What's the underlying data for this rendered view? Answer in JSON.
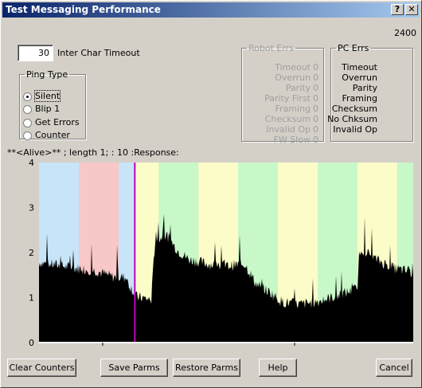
{
  "window": {
    "title": "Test Messaging Performance",
    "help_glyph": "?",
    "close_glyph": "✕"
  },
  "top_right_value": "2400",
  "inter_char": {
    "value": "30",
    "label": "Inter Char Timeout"
  },
  "ping_type": {
    "legend": "Ping Type",
    "options": [
      "Silent",
      "Blip 1",
      "Get Errors",
      "Counter"
    ],
    "selected": "Silent"
  },
  "robot_errs": {
    "legend": "Robot Errs",
    "rows": [
      {
        "label": "Timeout",
        "value": "0"
      },
      {
        "label": "Overrun",
        "value": "0"
      },
      {
        "label": "Parity",
        "value": "0"
      },
      {
        "label": "Parity First",
        "value": "0"
      },
      {
        "label": "Framing",
        "value": "0"
      },
      {
        "label": "Checksum",
        "value": "0"
      },
      {
        "label": "Invalid Op",
        "value": "0"
      },
      {
        "label": "FW Slow",
        "value": "0"
      }
    ]
  },
  "pc_errs": {
    "legend": "PC Errs",
    "rows": [
      "Timeout",
      "Overrun",
      "Parity",
      "Framing",
      "Checksum",
      "No Chksum",
      "Invalid Op"
    ]
  },
  "status_line": "**<Alive>** ; length 1; : 10  :Response:",
  "chart_data": {
    "type": "area",
    "ylim": [
      0,
      4
    ],
    "y_ticks": [
      "0",
      "1",
      "2",
      "3",
      "4"
    ],
    "bands": [
      {
        "from": 0.0,
        "to": 0.107,
        "color": "#c8e4f8"
      },
      {
        "from": 0.107,
        "to": 0.213,
        "color": "#f8c8c8"
      },
      {
        "from": 0.213,
        "to": 0.256,
        "color": "#c8e4f8"
      },
      {
        "from": 0.256,
        "to": 0.32,
        "color": "#fcfcc8"
      },
      {
        "from": 0.32,
        "to": 0.426,
        "color": "#c8f8c8"
      },
      {
        "from": 0.426,
        "to": 0.532,
        "color": "#fcfcc8"
      },
      {
        "from": 0.532,
        "to": 0.638,
        "color": "#c8f8c8"
      },
      {
        "from": 0.638,
        "to": 0.745,
        "color": "#fcfcc8"
      },
      {
        "from": 0.745,
        "to": 0.851,
        "color": "#c8f8c8"
      },
      {
        "from": 0.851,
        "to": 0.957,
        "color": "#fcfcc8"
      },
      {
        "from": 0.957,
        "to": 1.0,
        "color": "#c8f8c8"
      }
    ],
    "marker_x": 0.256,
    "marker_color": "#c000c0",
    "series_color": "#000000",
    "profile": [
      {
        "x": 0.0,
        "y": 1.78
      },
      {
        "x": 0.05,
        "y": 1.72
      },
      {
        "x": 0.1,
        "y": 1.65
      },
      {
        "x": 0.15,
        "y": 1.6
      },
      {
        "x": 0.2,
        "y": 1.45
      },
      {
        "x": 0.23,
        "y": 1.45
      },
      {
        "x": 0.26,
        "y": 1.02
      },
      {
        "x": 0.3,
        "y": 0.95
      },
      {
        "x": 0.31,
        "y": 2.25
      },
      {
        "x": 0.34,
        "y": 2.4
      },
      {
        "x": 0.37,
        "y": 2.05
      },
      {
        "x": 0.4,
        "y": 1.85
      },
      {
        "x": 0.45,
        "y": 1.75
      },
      {
        "x": 0.5,
        "y": 1.7
      },
      {
        "x": 0.55,
        "y": 1.75
      },
      {
        "x": 0.58,
        "y": 1.3
      },
      {
        "x": 0.62,
        "y": 1.1
      },
      {
        "x": 0.65,
        "y": 0.9
      },
      {
        "x": 0.7,
        "y": 0.85
      },
      {
        "x": 0.75,
        "y": 0.92
      },
      {
        "x": 0.8,
        "y": 1.05
      },
      {
        "x": 0.85,
        "y": 1.2
      },
      {
        "x": 0.86,
        "y": 2.1
      },
      {
        "x": 0.9,
        "y": 1.85
      },
      {
        "x": 0.95,
        "y": 1.65
      },
      {
        "x": 1.0,
        "y": 1.55
      }
    ]
  },
  "buttons": {
    "clear": "Clear Counters",
    "save": "Save Parms",
    "restore": "Restore Parms",
    "help": "Help",
    "cancel": "Cancel"
  }
}
